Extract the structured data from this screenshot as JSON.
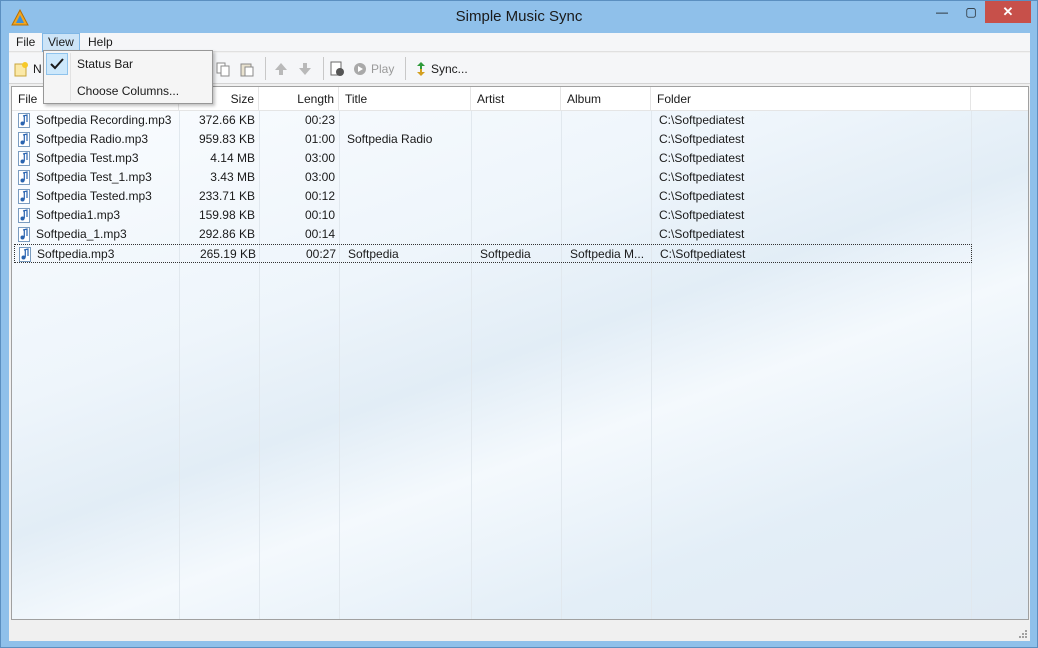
{
  "window": {
    "title": "Simple Music Sync",
    "minimize_glyph": "—",
    "maximize_glyph": "▢",
    "close_glyph": "✕"
  },
  "menu": {
    "file": "File",
    "view": "View",
    "help": "Help"
  },
  "view_menu": {
    "items": [
      {
        "label": "Status Bar",
        "checked": true
      },
      {
        "label": "Choose Columns..."
      }
    ]
  },
  "toolbar": {
    "new_label": "N",
    "play_label": "Play",
    "sync_label": "Sync..."
  },
  "columns": [
    "File",
    "Size",
    "Length",
    "Title",
    "Artist",
    "Album",
    "Folder"
  ],
  "rows": [
    {
      "file": "Softpedia Recording.mp3",
      "size": "372.66 KB",
      "length": "00:23",
      "title": "",
      "artist": "",
      "album": "",
      "folder": "C:\\Softpediatest"
    },
    {
      "file": "Softpedia Radio.mp3",
      "size": "959.83 KB",
      "length": "01:00",
      "title": "Softpedia Radio",
      "artist": "",
      "album": "",
      "folder": "C:\\Softpediatest"
    },
    {
      "file": "Softpedia Test.mp3",
      "size": "4.14 MB",
      "length": "03:00",
      "title": "",
      "artist": "",
      "album": "",
      "folder": "C:\\Softpediatest"
    },
    {
      "file": "Softpedia Test_1.mp3",
      "size": "3.43 MB",
      "length": "03:00",
      "title": "",
      "artist": "",
      "album": "",
      "folder": "C:\\Softpediatest"
    },
    {
      "file": "Softpedia Tested.mp3",
      "size": "233.71 KB",
      "length": "00:12",
      "title": "",
      "artist": "",
      "album": "",
      "folder": "C:\\Softpediatest"
    },
    {
      "file": "Softpedia1.mp3",
      "size": "159.98 KB",
      "length": "00:10",
      "title": "",
      "artist": "",
      "album": "",
      "folder": "C:\\Softpediatest"
    },
    {
      "file": "Softpedia_1.mp3",
      "size": "292.86 KB",
      "length": "00:14",
      "title": "",
      "artist": "",
      "album": "",
      "folder": "C:\\Softpediatest"
    },
    {
      "file": "Softpedia.mp3",
      "size": "265.19 KB",
      "length": "00:27",
      "title": "Softpedia",
      "artist": "Softpedia",
      "album": "Softpedia M...",
      "folder": "C:\\Softpediatest",
      "selected": true
    }
  ],
  "colors": {
    "titlebar": "#8fc0ea",
    "close_button": "#c7504a",
    "menu_highlight": "#cce4f7",
    "sync_icon": "#2e9a3a"
  }
}
